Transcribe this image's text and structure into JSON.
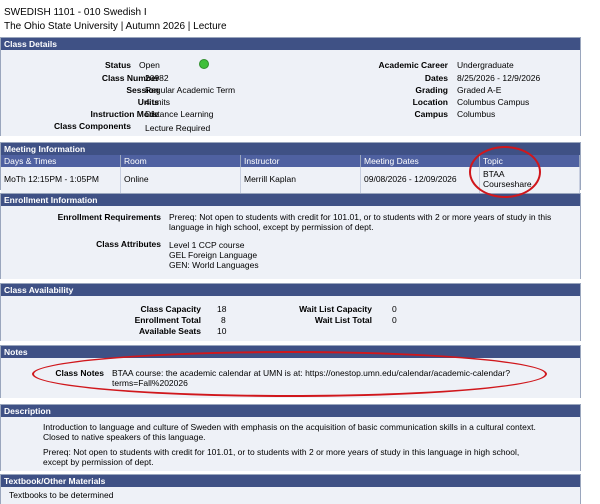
{
  "header": {
    "course": "SWEDISH 1101 - 010   Swedish I",
    "subtitle": "The Ohio State University | Autumn 2026 | Lecture"
  },
  "class_details": {
    "title": "Class Details",
    "status_label": "Status",
    "status": "Open",
    "status_color": "#3fbf3a",
    "class_number_label": "Class Number",
    "class_number": "20982",
    "session_label": "Session",
    "session": "Regular Academic Term",
    "units_label": "Units",
    "units": "4 units",
    "instruction_mode_label": "Instruction Mode",
    "instruction_mode": "Distance Learning",
    "class_components_label": "Class Components",
    "class_components": "Lecture Required",
    "career_label": "Academic Career",
    "career": "Undergraduate",
    "dates_label": "Dates",
    "dates": "8/25/2026 - 12/9/2026",
    "grading_label": "Grading",
    "grading": "Graded A-E",
    "location_label": "Location",
    "location": "Columbus Campus",
    "campus_label": "Campus",
    "campus": "Columbus"
  },
  "meeting_info": {
    "title": "Meeting Information",
    "columns": [
      "Days & Times",
      "Room",
      "Instructor",
      "Meeting Dates",
      "Topic"
    ],
    "row": {
      "days_times": "MoTh 12:15PM - 1:05PM",
      "room": "Online",
      "instructor": "Merrill Kaplan",
      "meeting_dates": "09/08/2026 - 12/09/2026",
      "topic_line1": "BTAA",
      "topic_line2": "Courseshare"
    }
  },
  "enrollment_info": {
    "title": "Enrollment Information",
    "requirements_label": "Enrollment Requirements",
    "requirements": "Prereq: Not open to students with credit for 101.01, or to students with 2 or more years of study in this language in high school, except by permission of dept.",
    "attributes_label": "Class Attributes",
    "attributes": [
      "Level 1 CCP course",
      "GEL Foreign Language",
      "GEN: World Languages"
    ]
  },
  "class_availability": {
    "title": "Class Availability",
    "capacity_label": "Class Capacity",
    "capacity": "18",
    "enrollment_total_label": "Enrollment Total",
    "enrollment_total": "8",
    "available_seats_label": "Available Seats",
    "available_seats": "10",
    "waitlist_capacity_label": "Wait List Capacity",
    "waitlist_capacity": "0",
    "waitlist_total_label": "Wait List Total",
    "waitlist_total": "0"
  },
  "notes": {
    "title": "Notes",
    "class_notes_label": "Class Notes",
    "class_notes": "BTAA course: the academic calendar at UMN is at: https://onestop.umn.edu/calendar/academic-calendar?terms=Fall%202026"
  },
  "description": {
    "title": "Description",
    "para1": "Introduction to language and culture of Sweden with emphasis on the acquisition of basic communication skills in a cultural context. Closed to native speakers of this language.",
    "para2": "Prereq: Not open to students with credit for 101.01, or to students with 2 or more years of study in this language in high school, except by permission of dept."
  },
  "textbook": {
    "title": "Textbook/Other Materials",
    "text": "Textbooks to be determined"
  },
  "annotation_color": "#d0171c"
}
